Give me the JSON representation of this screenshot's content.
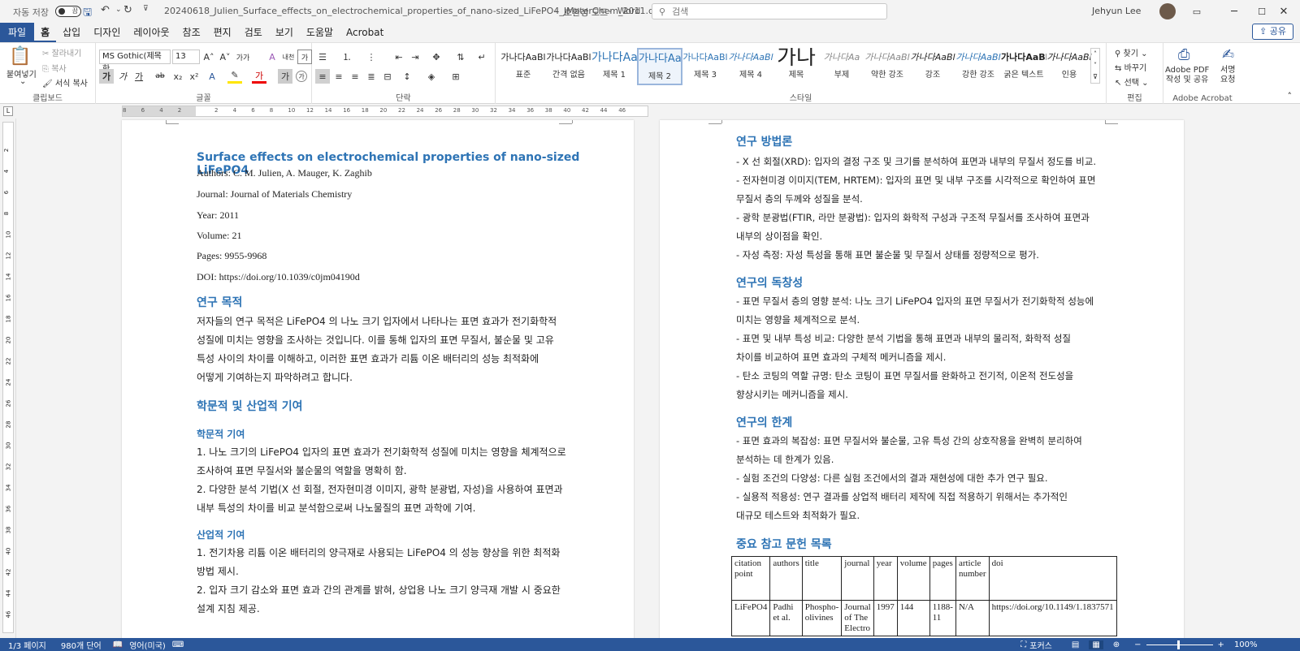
{
  "titlebar": {
    "autosave_label": "자동 저장",
    "autosave_state": "끔",
    "filename": "20240618_Julien_Surface_effects_on_electrochemical_properties_of_nano-sized_LiFePO4_JMaterChem_2011.docx",
    "mode": "호환성 모드",
    "app": "Word",
    "search_placeholder": "검색",
    "user": "Jehyun Lee"
  },
  "menu": {
    "items": [
      "파일",
      "홈",
      "삽입",
      "디자인",
      "레이아웃",
      "참조",
      "편지",
      "검토",
      "보기",
      "도움말",
      "Acrobat"
    ],
    "share": "공유"
  },
  "ribbon": {
    "clipboard": {
      "paste": "붙여넣기",
      "cut": "잘라내기",
      "copy": "복사",
      "format_painter": "서식 복사",
      "label": "클립보드"
    },
    "font": {
      "name": "MS Gothic(제목 한",
      "size": "13",
      "label": "글꼴"
    },
    "paragraph": {
      "label": "단락"
    },
    "styles": {
      "label": "스타일",
      "items": [
        {
          "sample": "가나다AaBl",
          "name": "표준"
        },
        {
          "sample": "가나다AaBl",
          "name": "간격 없음"
        },
        {
          "sample": "가나다Aa",
          "name": "제목 1"
        },
        {
          "sample": "가나다AaI",
          "name": "제목 2"
        },
        {
          "sample": "가나다AaBl",
          "name": "제목 3"
        },
        {
          "sample": "가나다AaBl",
          "name": "제목 4"
        },
        {
          "sample": "가나",
          "name": "제목"
        },
        {
          "sample": "가나다Aa",
          "name": "부제"
        },
        {
          "sample": "가나다AaBl",
          "name": "약한 강조"
        },
        {
          "sample": "가나다AaBl",
          "name": "강조"
        },
        {
          "sample": "가나다AaBl",
          "name": "강한 강조"
        },
        {
          "sample": "가나다AaBl",
          "name": "굵은 텍스트"
        },
        {
          "sample": "가나다AaBl",
          "name": "인용"
        }
      ]
    },
    "editing": {
      "find": "찾기",
      "replace": "바꾸기",
      "select": "선택",
      "label": "편집"
    },
    "acrobat": {
      "create": "Adobe PDF\n작성 및 공유",
      "sign": "서명\n요청",
      "label": "Adobe Acrobat"
    }
  },
  "ruler_ticks": [
    "8",
    "6",
    "4",
    "2",
    "",
    "2",
    "4",
    "6",
    "8",
    "10",
    "12",
    "14",
    "16",
    "18",
    "20",
    "22",
    "24",
    "26",
    "28",
    "30",
    "32",
    "34",
    "36",
    "38",
    "40",
    "42",
    "44",
    "46"
  ],
  "vruler_ticks": [
    "2",
    "4",
    "6",
    "8",
    "10",
    "12",
    "14",
    "16",
    "18",
    "20",
    "22",
    "24",
    "26",
    "28",
    "30",
    "32",
    "34",
    "36",
    "38",
    "40",
    "42",
    "44",
    "46"
  ],
  "page1": {
    "title": "Surface effects on electrochemical properties of nano-sized LiFePO4",
    "authors": "Authors: C. M. Julien, A. Mauger, K. Zaghib",
    "journal": "Journal: Journal of Materials Chemistry",
    "year": "Year: 2011",
    "volume": "Volume: 21",
    "pages": "Pages: 9955-9968",
    "doi": "DOI: https://doi.org/10.1039/c0jm04190d",
    "h_purpose": "연구 목적",
    "purpose_lines": [
      "저자들의 연구 목적은 LiFePO4 의 나노 크기 입자에서 나타나는 표면 효과가 전기화학적",
      "성질에 미치는 영향을 조사하는 것입니다. 이를 통해 입자의 표면 무질서, 불순물 및 고유",
      "특성 사이의 차이를 이해하고, 이러한 표면 효과가 리튬 이온 배터리의 성능 최적화에",
      "어떻게 기여하는지 파악하려고 합니다."
    ],
    "h_contrib": "학문적 및 산업적 기여",
    "h_academic": "학문적 기여",
    "academic_lines": [
      "1. 나노 크기의 LiFePO4 입자의 표면 효과가 전기화학적 성질에 미치는 영향을 체계적으로",
      "조사하여 표면 무질서와 불순물의 역할을 명확히 함.",
      "2. 다양한 분석 기법(X 선 회절, 전자현미경 이미지, 광학 분광법, 자성)을 사용하여 표면과",
      "내부 특성의 차이를 비교 분석함으로써 나노물질의 표면 과학에 기여."
    ],
    "h_industrial": "산업적 기여",
    "industrial_lines": [
      "1. 전기차용 리튬 이온 배터리의 양극재로 사용되는 LiFePO4 의 성능 향상을 위한 최적화",
      "방법 제시.",
      "2. 입자 크기 감소와 표면 효과 간의 관계를 밝혀, 상업용 나노 크기 양극재 개발 시 중요한",
      "설계 지침 제공."
    ]
  },
  "page2": {
    "h_method": "연구 방법론",
    "method_lines": [
      "- X 선 회절(XRD): 입자의 결정 구조 및 크기를 분석하여 표면과 내부의 무질서 정도를 비교.",
      "- 전자현미경 이미지(TEM, HRTEM): 입자의 표면 및 내부 구조를 시각적으로 확인하여 표면",
      "무질서 층의 두께와 성질을 분석.",
      "- 광학 분광법(FTIR, 라만 분광법): 입자의 화학적 구성과 구조적 무질서를 조사하여 표면과",
      "내부의 상이점을 확인.",
      "- 자성 측정: 자성 특성을 통해 표면 불순물 및 무질서 상태를 정량적으로 평가."
    ],
    "h_orig": "연구의 독창성",
    "orig_lines": [
      "- 표면 무질서 층의 영향 분석: 나노 크기 LiFePO4 입자의 표면 무질서가 전기화학적 성능에",
      "미치는 영향을 체계적으로 분석.",
      "- 표면 및 내부 특성 비교: 다양한 분석 기법을 통해 표면과 내부의 물리적, 화학적 성질",
      "차이를 비교하여 표면 효과의 구체적 메커니즘을 제시.",
      "- 탄소 코팅의 역할 규명: 탄소 코팅이 표면 무질서를 완화하고 전기적, 이온적 전도성을",
      "향상시키는 메커니즘을 제시."
    ],
    "h_limit": "연구의 한계",
    "limit_lines": [
      "- 표면 효과의 복잡성: 표면 무질서와 불순물, 고유 특성 간의 상호작용을 완벽히 분리하여",
      "분석하는 데 한계가 있음.",
      "- 실험 조건의 다양성: 다른 실험 조건에서의 결과 재현성에 대한 추가 연구 필요.",
      "- 실용적 적용성: 연구 결과를 상업적 배터리 제작에 직접 적용하기 위해서는 추가적인",
      "대규모 테스트와 최적화가 필요."
    ],
    "h_refs": "중요 참고 문헌 목록",
    "table_header": [
      "citation point",
      "authors",
      "title",
      "journal",
      "year",
      "volume",
      "pages",
      "article number",
      "doi"
    ],
    "table_row": [
      "LiFePO4",
      "Padhi et al.",
      "Phospho-olivines",
      "Journal of The Electro",
      "1997",
      "144",
      "1188-11",
      "N/A",
      "https://doi.org/10.1149/1.1837571"
    ]
  },
  "status": {
    "page": "1/3 페이지",
    "words": "980개 단어",
    "lang": "영어(미국)",
    "focus": "포커스",
    "zoom": "100%"
  }
}
